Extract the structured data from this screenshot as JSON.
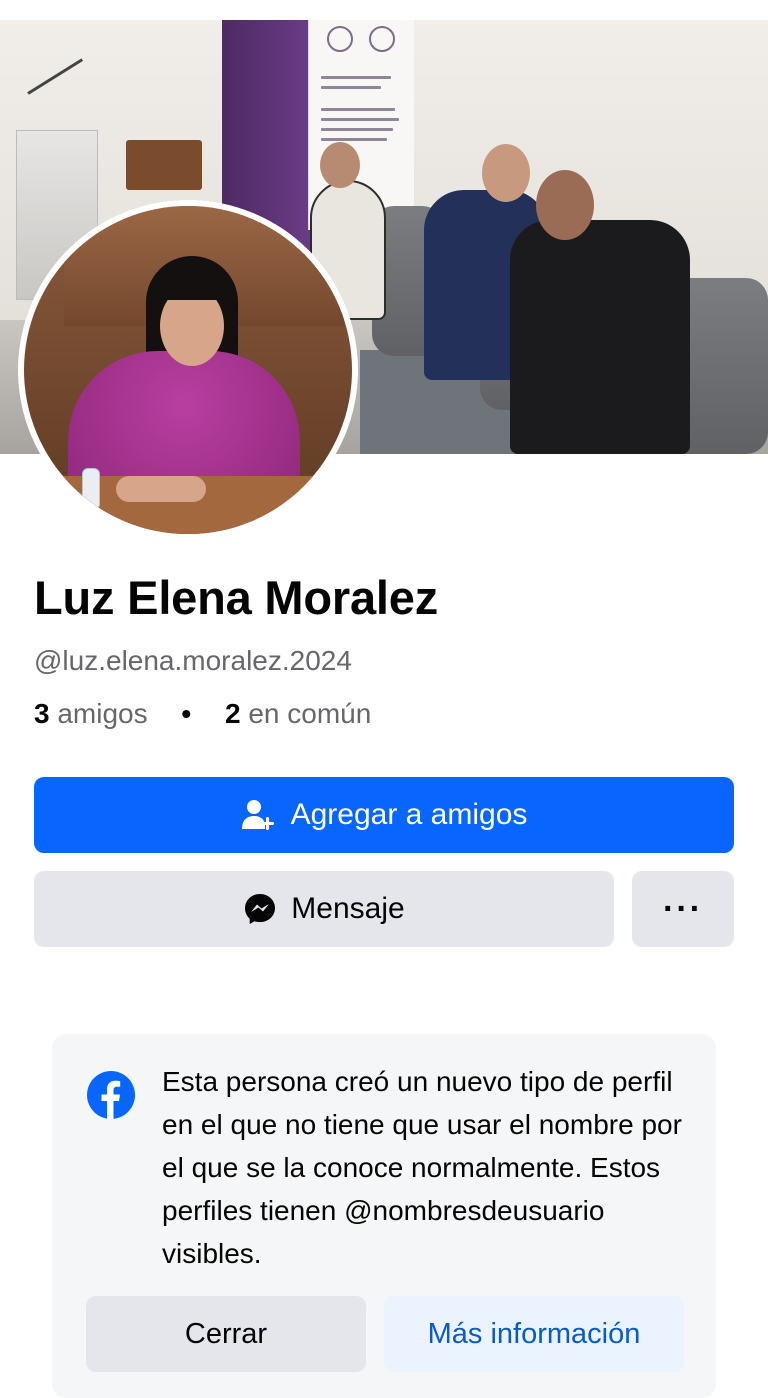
{
  "profile": {
    "name": "Luz Elena Moralez",
    "username": "@luz.elena.moralez.2024",
    "friends_count": "3",
    "friends_label": "amigos",
    "separator": "•",
    "mutual_count": "2",
    "mutual_label": "en común"
  },
  "actions": {
    "add_friend_label": "Agregar a amigos",
    "message_label": "Mensaje",
    "more_label": "···"
  },
  "notice": {
    "text": "Esta persona creó un nuevo tipo de perfil en el que no tiene que usar el nombre por el que se la conoce normalmente. Estos perfiles tienen @nombresdeusuario visibles.",
    "close_label": "Cerrar",
    "more_info_label": "Más información"
  },
  "icons": {
    "add_friend": "add-person-icon",
    "message": "messenger-icon",
    "notice": "facebook-logo"
  },
  "colors": {
    "primary": "#0866ff",
    "secondary_button": "#e4e6eb",
    "link_blue": "#0a5bc4",
    "muted_text": "#65676b"
  }
}
